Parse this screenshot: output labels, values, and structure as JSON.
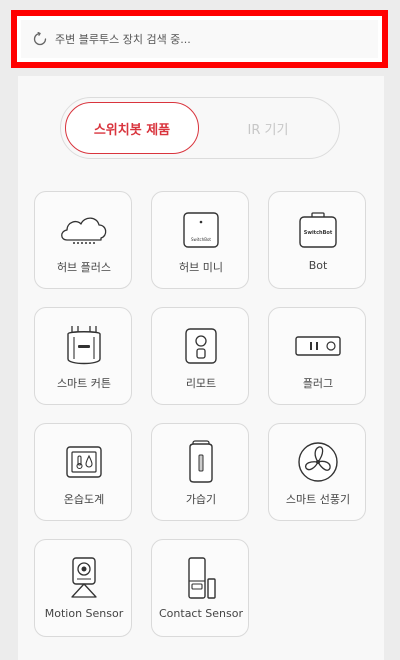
{
  "scan": {
    "icon": "spinner-icon",
    "text": "주변 블루투스 장치 검색 중..."
  },
  "segment": {
    "active_label": "스위치봇 제품",
    "inactive_label": "IR 기기"
  },
  "colors": {
    "accent": "#d9343d",
    "highlight": "#ff0000"
  },
  "devices": [
    {
      "label": "허브 플러스",
      "icon": "cloud-hub-icon"
    },
    {
      "label": "허브 미니",
      "icon": "hub-mini-icon",
      "brand": "SwitchBot"
    },
    {
      "label": "Bot",
      "icon": "bot-icon",
      "brand": "SwitchBot"
    },
    {
      "label": "스마트 커튼",
      "icon": "curtain-icon"
    },
    {
      "label": "리모트",
      "icon": "remote-icon"
    },
    {
      "label": "플러그",
      "icon": "plug-icon"
    },
    {
      "label": "온습도계",
      "icon": "thermometer-icon"
    },
    {
      "label": "가습기",
      "icon": "humidifier-icon"
    },
    {
      "label": "스마트 선풍기",
      "icon": "fan-icon"
    },
    {
      "label": "Motion Sensor",
      "icon": "motion-sensor-icon"
    },
    {
      "label": "Contact Sensor",
      "icon": "contact-sensor-icon"
    }
  ]
}
